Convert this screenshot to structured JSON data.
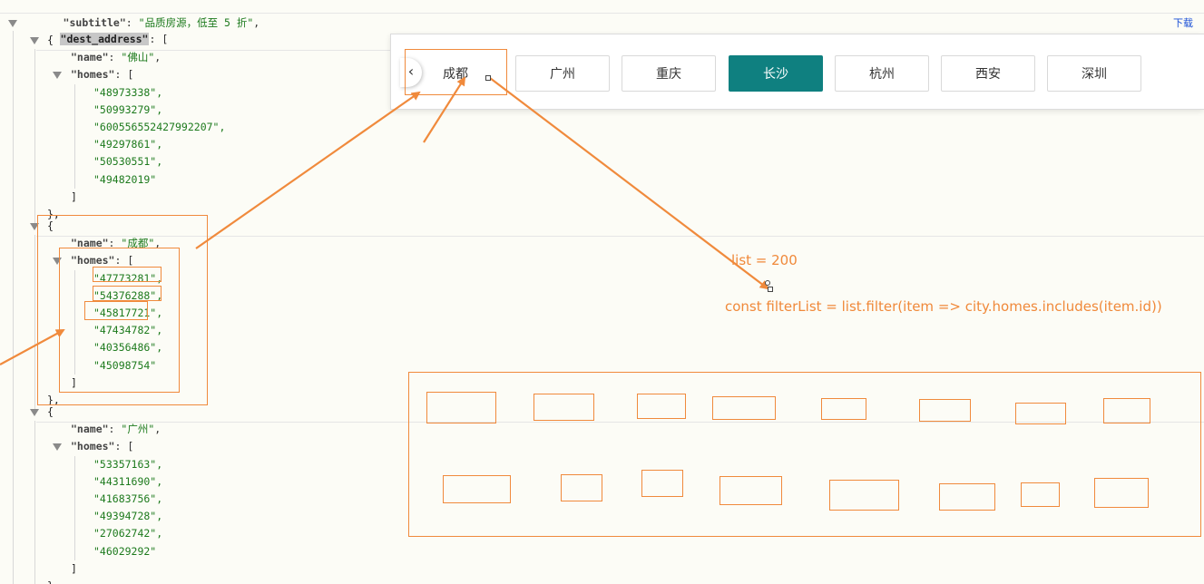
{
  "json_view": {
    "subtitle_line": {
      "key": "\"subtitle\"",
      "colon": ": ",
      "value": "\"品质房源，低至 5 折\"",
      "tail": ","
    },
    "dest_key": "\"dest_address\"",
    "dest_open": ": [",
    "groups": [
      {
        "name": "佛山",
        "homes": [
          "\"48973338\",",
          "\"50993279\",",
          "\"600556552427992207\",",
          "\"49297861\",",
          "\"50530551\",",
          "\"49482019\""
        ]
      },
      {
        "name": "成都",
        "homes": [
          "\"47773281\",",
          "\"54376288\",",
          "\"45817721\",",
          "\"47434782\",",
          "\"40356486\",",
          "\"45098754\""
        ]
      },
      {
        "name": "广州",
        "homes": [
          "\"53357163\",",
          "\"44311690\",",
          "\"41683756\",",
          "\"49394728\",",
          "\"27062742\",",
          "\"46029292\""
        ]
      }
    ],
    "name_key": "\"name\"",
    "homes_key": "\"homes\"",
    "download_label": "下载"
  },
  "city_tabs": {
    "prev_icon": "chevron-left-icon",
    "prev_glyph": "‹",
    "items": [
      "成都",
      "广州",
      "重庆",
      "长沙",
      "杭州",
      "西安",
      "深圳"
    ],
    "active_index": 3,
    "active_color": "#0f8080"
  },
  "annotations": {
    "list_text": "list = 200",
    "filter_code": "const filterList = list.filter(item => city.homes.includes(item.id))",
    "color": "#f08a3c"
  }
}
